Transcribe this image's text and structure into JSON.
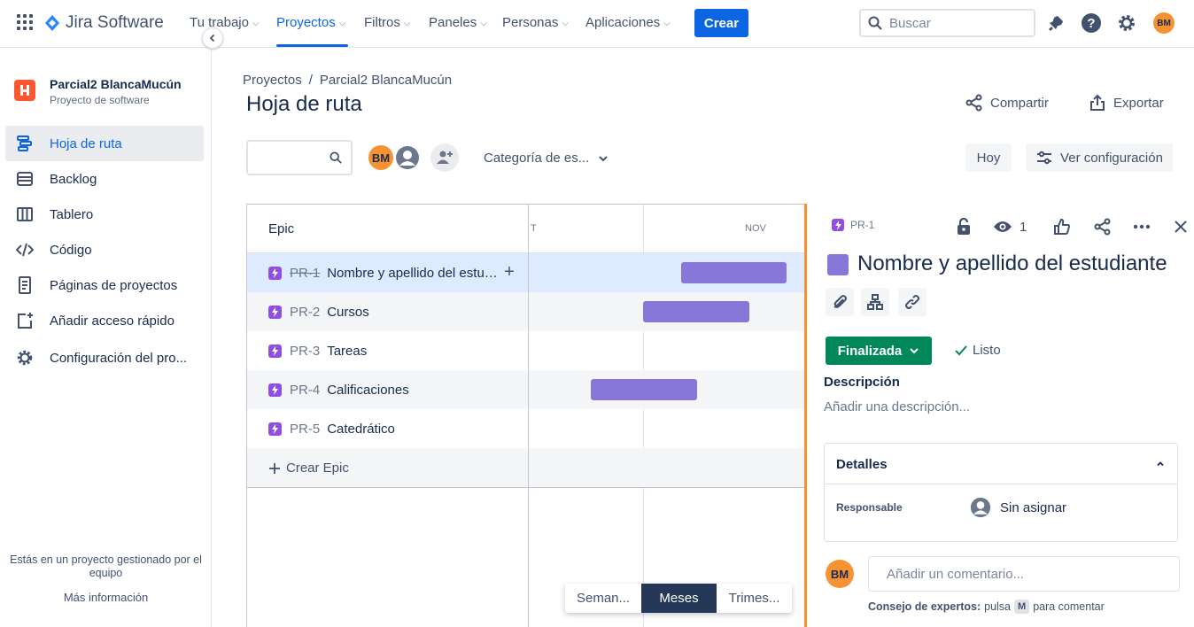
{
  "nav": {
    "app_name": "Jira Software",
    "items": [
      {
        "label": "Tu trabajo"
      },
      {
        "label": "Proyectos"
      },
      {
        "label": "Filtros"
      },
      {
        "label": "Paneles"
      },
      {
        "label": "Personas"
      },
      {
        "label": "Aplicaciones"
      }
    ],
    "active_item": "Proyectos",
    "create_label": "Crear",
    "search_placeholder": "Buscar",
    "user_initials": "BM",
    "accent_color": "#0c66e4"
  },
  "sidebar": {
    "project_name": "Parcial2 BlancaMucún",
    "project_type": "Proyecto de software",
    "items": [
      {
        "label": "Hoja de ruta",
        "icon": "roadmap-icon",
        "active": true
      },
      {
        "label": "Backlog",
        "icon": "backlog-icon"
      },
      {
        "label": "Tablero",
        "icon": "board-icon"
      },
      {
        "label": "Código",
        "icon": "code-icon"
      },
      {
        "label": "Páginas de proyectos",
        "icon": "pages-icon"
      },
      {
        "label": "Añadir acceso rápido",
        "icon": "add-shortcut-icon"
      },
      {
        "label": "Configuración del pro...",
        "icon": "gear-icon"
      }
    ],
    "footer_text": "Estás en un proyecto gestionado por el equipo",
    "footer_link": "Más información"
  },
  "header": {
    "breadcrumb": [
      "Proyectos",
      "Parcial2 BlancaMucún"
    ],
    "breadcrumb_sep": "/",
    "title": "Hoja de ruta",
    "share_label": "Compartir",
    "export_label": "Exportar"
  },
  "filters": {
    "search_value": "",
    "avatar_initials": "BM",
    "category_label": "Categoría de es...",
    "today_label": "Hoy",
    "settings_label": "Ver configuración"
  },
  "roadmap": {
    "column_header": "Epic",
    "months": [
      "T",
      "NOV"
    ],
    "epics": [
      {
        "key": "PR-1",
        "title": "Nombre y apellido del estudi...",
        "done": true,
        "selected": true
      },
      {
        "key": "PR-2",
        "title": "Cursos",
        "done": false
      },
      {
        "key": "PR-3",
        "title": "Tareas",
        "done": false
      },
      {
        "key": "PR-4",
        "title": "Calificaciones",
        "done": false
      },
      {
        "key": "PR-5",
        "title": "Catedrático",
        "done": false
      }
    ],
    "create_epic_label": "Crear Epic",
    "bar_color": "#8777d9",
    "timescale": [
      "Seman...",
      "Meses",
      "Trimes..."
    ],
    "timescale_active": "Meses"
  },
  "panel": {
    "issue_key": "PR-1",
    "watchers": "1",
    "title": "Nombre y apellido del estudiante",
    "status": "Finalizada",
    "status_color": "#00875a",
    "resolution": "Listo",
    "description_label": "Descripción",
    "description_placeholder": "Añadir una descripción...",
    "details_label": "Detalles",
    "assignee_label": "Responsable",
    "assignee_value": "Sin asignar",
    "comment_avatar": "BM",
    "comment_placeholder": "Añadir un comentario...",
    "tip_bold": "Consejo de expertos:",
    "tip_press": "pulsa",
    "tip_key": "M",
    "tip_rest": "para comentar"
  }
}
